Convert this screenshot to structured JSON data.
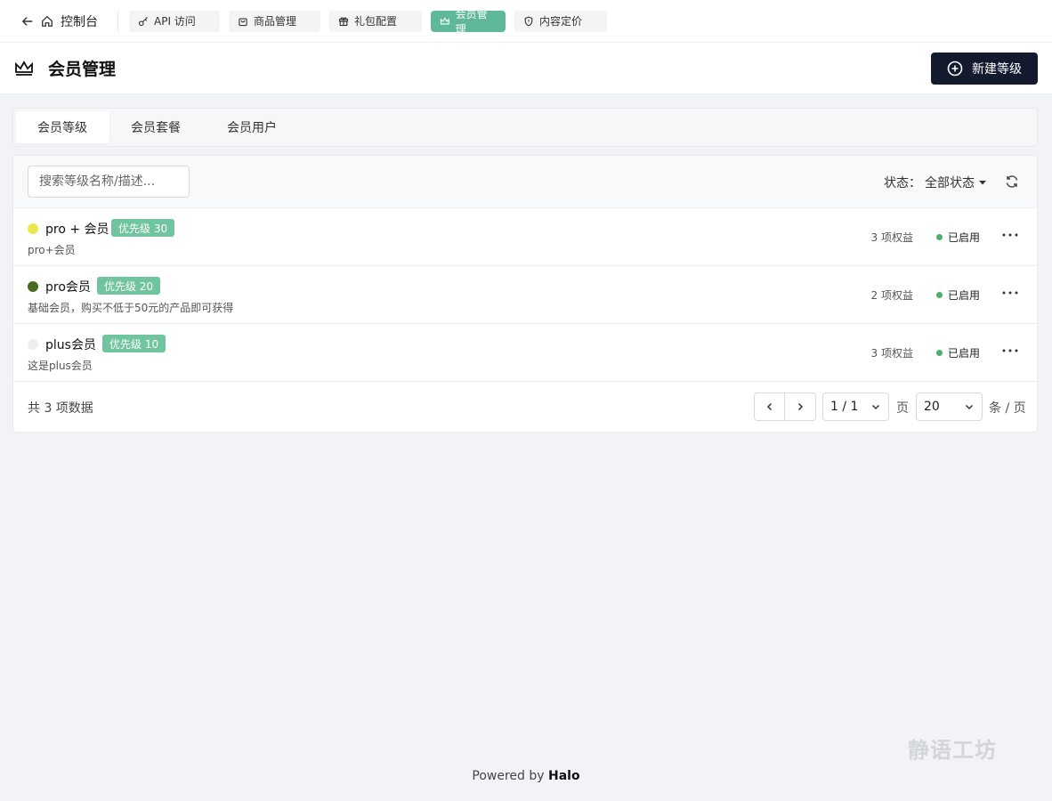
{
  "topnav": {
    "back_label": "控制台",
    "tabs": [
      {
        "label": "API 访问",
        "icon": "key-icon"
      },
      {
        "label": "商品管理",
        "icon": "shopping-bag-icon"
      },
      {
        "label": "礼包配置",
        "icon": "gift-icon"
      },
      {
        "label": "会员管理",
        "icon": "crown-icon",
        "active": true
      },
      {
        "label": "内容定价",
        "icon": "shield-icon"
      }
    ]
  },
  "header": {
    "title": "会员管理",
    "new_button_label": "新建等级"
  },
  "tabs": [
    "会员等级",
    "会员套餐",
    "会员用户"
  ],
  "toolbar": {
    "search_placeholder": "搜索等级名称/描述...",
    "status_label": "状态：",
    "status_value": "全部状态"
  },
  "levels": [
    {
      "name": "pro + 会员",
      "priority": "优先级 30",
      "description": "pro+会员",
      "benefits": "3 项权益",
      "status": "已启用",
      "color": "#ece74a"
    },
    {
      "name": "pro会员",
      "priority": "优先级 20",
      "description": "基础会员，购买不低于50元的产品即可获得",
      "benefits": "2 项权益",
      "status": "已启用",
      "color": "#4a6a1f"
    },
    {
      "name": "plus会员",
      "priority": "优先级 10",
      "description": "这是plus会员",
      "benefits": "3 项权益",
      "status": "已启用",
      "color": "#eceef0"
    }
  ],
  "pagination": {
    "total": "共 3 项数据",
    "page_value": "1 / 1",
    "page_label": "页",
    "size_value": "20",
    "size_label": "条 / 页"
  },
  "footer": {
    "powered_prefix": "Powered by",
    "powered_brand": "Halo",
    "watermark": "静语工坊"
  },
  "colors": {
    "accent": "#5fb89a",
    "badge": "#70c49e",
    "primary_button": "#131a2e",
    "enabled_dot": "#4caf6a"
  }
}
